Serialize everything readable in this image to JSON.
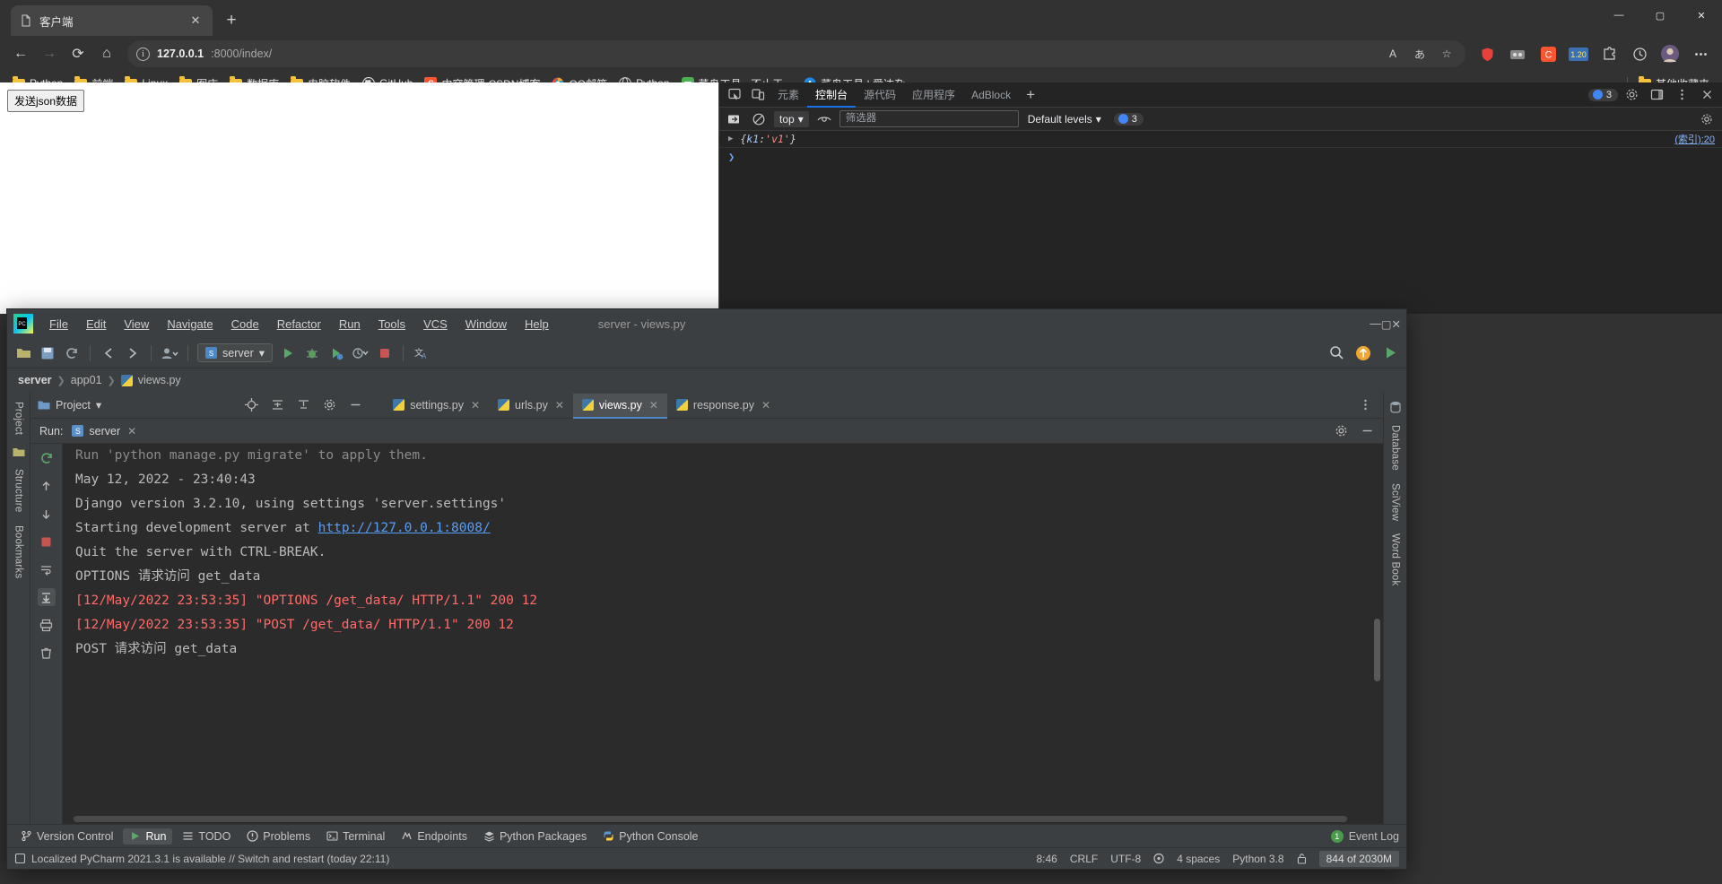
{
  "browser": {
    "tab": {
      "title": "客户端",
      "icon": "document-icon",
      "close_label": "✕"
    },
    "newtab_label": "+",
    "window_controls": {
      "minimize": "—",
      "maximize": "▢",
      "close": "✕"
    },
    "nav": {
      "back": "←",
      "forward": "→",
      "reload": "⟳",
      "home": "⌂"
    },
    "omnibox": {
      "info_icon": "ⓘ",
      "url_host": "127.0.0.1",
      "url_rest": ":8000/index/",
      "read_aloud": "A",
      "translate": "あ",
      "favorite": "☆"
    },
    "bookmarks": [
      {
        "label": "Python",
        "icon": "folder-icon",
        "type": "folder"
      },
      {
        "label": "前端",
        "icon": "folder-icon",
        "type": "folder"
      },
      {
        "label": "Linux",
        "icon": "folder-icon",
        "type": "folder"
      },
      {
        "label": "图床",
        "icon": "folder-icon",
        "type": "folder"
      },
      {
        "label": "数据库",
        "icon": "folder-icon",
        "type": "folder"
      },
      {
        "label": "电脑软件",
        "icon": "folder-icon",
        "type": "folder"
      },
      {
        "label": "GitHub",
        "icon": "github-icon",
        "type": "site",
        "color": "#e8e8e8"
      },
      {
        "label": "内容管理-CSDN博客",
        "icon": "csdn-icon",
        "type": "site",
        "color": "#fc5531"
      },
      {
        "label": "QQ邮箱",
        "icon": "qqmail-icon",
        "type": "site",
        "color": "#2ba3dd"
      },
      {
        "label": "Python",
        "icon": "python-globe-icon",
        "type": "site",
        "color": "#cccccc"
      },
      {
        "label": "菜鸟工具 - 不止于...",
        "icon": "runoob-icon",
        "type": "site",
        "color": "#4caf50"
      },
      {
        "label": "菜鸟工具 | 爱达杂...",
        "icon": "circle-a-icon",
        "type": "site",
        "color": "#1e88e5"
      }
    ],
    "other_favorites": {
      "label": "其他收藏夹",
      "icon": "folder-icon"
    }
  },
  "page": {
    "button_label": "发送json数据"
  },
  "devtools": {
    "tabs": [
      {
        "label": "元素",
        "active": false
      },
      {
        "label": "控制台",
        "active": true
      },
      {
        "label": "源代码",
        "active": false
      },
      {
        "label": "应用程序",
        "active": false
      },
      {
        "label": "AdBlock",
        "active": false
      }
    ],
    "add_tab_label": "+",
    "inspect_icon": "inspect-icon",
    "device_icon": "device-toolbar-icon",
    "issues_count": "3",
    "settings_icon": "gear-icon",
    "dock_icon": "dock-side-icon",
    "more_icon": "more-vertical-icon",
    "close_icon": "close-icon",
    "filterbar": {
      "sidebar_icon": "console-sidebar-icon",
      "clear_icon": "clear-console-icon",
      "context": "top",
      "eye_icon": "live-expression-icon",
      "filter_placeholder": "筛选器",
      "levels": "Default levels",
      "error_count": "3",
      "settings_icon": "console-settings-icon"
    },
    "console_messages": [
      {
        "expand": "▶",
        "text_open": "{",
        "key": "k1",
        "colon": ": ",
        "value": "'v1'",
        "text_close": "}",
        "source": "(索引):20"
      }
    ],
    "prompt": "❯"
  },
  "pycharm": {
    "window_title": "server - views.py",
    "menus": [
      "File",
      "Edit",
      "View",
      "Navigate",
      "Code",
      "Refactor",
      "Run",
      "Tools",
      "VCS",
      "Window",
      "Help"
    ],
    "window_controls": {
      "minimize": "—",
      "maximize": "▢",
      "close": "✕"
    },
    "toolbar": {
      "run_config": "server",
      "open_icon": "open-folder-icon",
      "save_icon": "save-icon",
      "sync_icon": "sync-icon",
      "back_icon": "back-arrow-icon",
      "forward_icon": "forward-arrow-icon",
      "profile_icon": "user-icon",
      "run_icon": "run-green-arrow-icon",
      "debug_icon": "debug-bug-icon",
      "coverage_icon": "coverage-icon",
      "profiler_icon": "profiler-icon",
      "stop_icon": "stop-square-icon",
      "translate_icon": "translate-icon",
      "search_icon": "search-icon",
      "update_icon": "update-badge-icon",
      "run_right_icon": "run-arrow-icon"
    },
    "breadcrumb": [
      "server",
      "app01",
      "views.py"
    ],
    "project_panel": {
      "label": "Project",
      "icon": "project-folder-icon",
      "chevron": "▾"
    },
    "left_rail": [
      "Project",
      "Structure",
      "Bookmarks"
    ],
    "right_rail": [
      "Database",
      "SciView",
      "Word Book"
    ],
    "editor_tabs": [
      {
        "label": "settings.py",
        "active": false
      },
      {
        "label": "urls.py",
        "active": false
      },
      {
        "label": "views.py",
        "active": true
      },
      {
        "label": "response.py",
        "active": false
      }
    ],
    "run_panel": {
      "title": "Run:",
      "config_name": "server",
      "config_badge": "S",
      "close": "✕",
      "settings_icon": "gear-icon",
      "minimize_icon": "minimize-icon",
      "rail_icons": [
        "rerun-icon",
        "up-arrow-icon",
        "down-arrow-icon",
        "stop-icon",
        "soft-wrap-icon",
        "scroll-to-end-icon",
        "print-icon",
        "trash-icon"
      ]
    },
    "console_lines": [
      {
        "text": "Run 'python manage.py migrate' to apply them.",
        "style": "clipped"
      },
      {
        "text": "May 12, 2022 - 23:40:43",
        "style": "normal"
      },
      {
        "text": "Django version 3.2.10, using settings 'server.settings'",
        "style": "normal"
      },
      {
        "text": "Starting development server at ",
        "link": "http://127.0.0.1:8008/",
        "style": "link"
      },
      {
        "text": "Quit the server with CTRL-BREAK.",
        "style": "normal"
      },
      {
        "text": "OPTIONS 请求访问 get_data",
        "style": "normal"
      },
      {
        "text": "[12/May/2022 23:53:35] \"OPTIONS /get_data/ HTTP/1.1\" 200 12",
        "style": "error"
      },
      {
        "text": "[12/May/2022 23:53:35] \"POST /get_data/ HTTP/1.1\" 200 12",
        "style": "error"
      },
      {
        "text": "POST 请求访问 get_data",
        "style": "normal"
      }
    ],
    "bottom_tools": [
      {
        "label": "Version Control",
        "icon": "branch-icon",
        "active": false
      },
      {
        "label": "Run",
        "icon": "run-arrow-icon",
        "active": true
      },
      {
        "label": "TODO",
        "icon": "list-icon",
        "active": false
      },
      {
        "label": "Problems",
        "icon": "warning-icon",
        "active": false
      },
      {
        "label": "Terminal",
        "icon": "terminal-icon",
        "active": false
      },
      {
        "label": "Endpoints",
        "icon": "endpoints-icon",
        "active": false
      },
      {
        "label": "Python Packages",
        "icon": "packages-icon",
        "active": false
      },
      {
        "label": "Python Console",
        "icon": "python-icon",
        "active": false
      }
    ],
    "event_log": {
      "count": "1",
      "label": "Event Log"
    },
    "status_message": "Localized PyCharm 2021.3.1 is available // Switch and restart (today 22:11)",
    "status_icon": "notification-icon",
    "status_right": {
      "caret": "8:46",
      "line_sep": "CRLF",
      "encoding": "UTF-8",
      "lock_icon": "lock-icon",
      "indent": "4 spaces",
      "interpreter": "Python 3.8",
      "memory": "844 of 2030M"
    }
  }
}
